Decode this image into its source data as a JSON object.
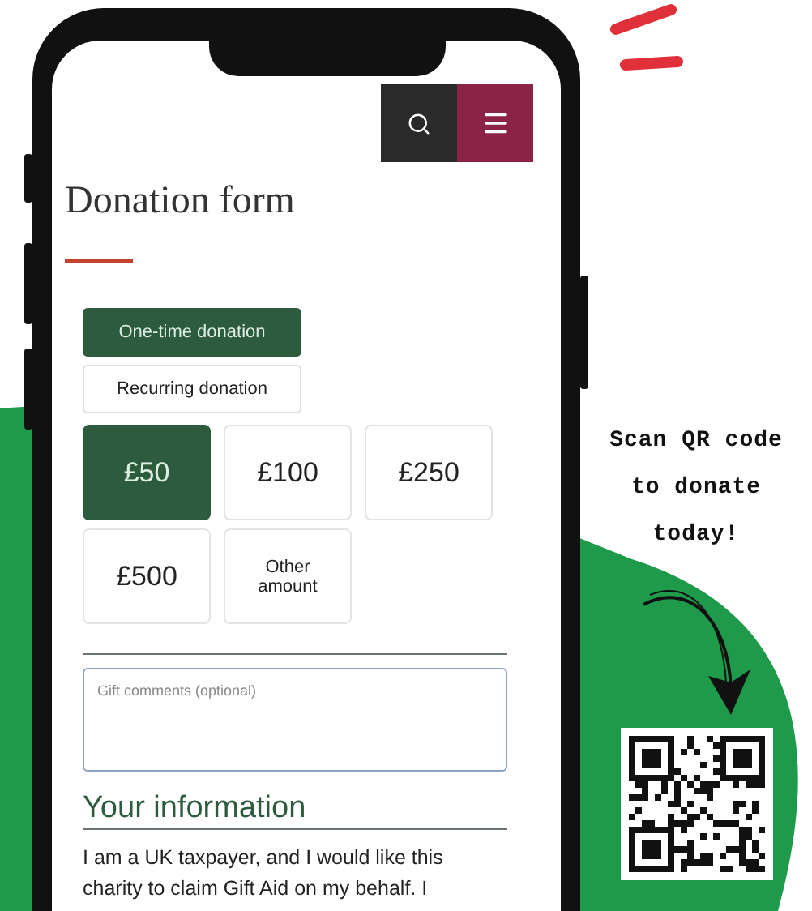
{
  "phone_screen": {
    "title": "Donation form",
    "donation_types": [
      {
        "label": "One-time donation",
        "selected": true
      },
      {
        "label": "Recurring donation",
        "selected": false
      }
    ],
    "amounts": [
      {
        "label": "£50",
        "selected": true
      },
      {
        "label": "£100",
        "selected": false
      },
      {
        "label": "£250",
        "selected": false
      },
      {
        "label": "£500",
        "selected": false
      },
      {
        "label": "Other amount",
        "selected": false
      }
    ],
    "comments_field": {
      "placeholder": "Gift comments (optional)"
    },
    "section_heading": "Your information",
    "gift_aid_text": "I am a UK taxpayer, and I would like this charity to claim Gift Aid on my behalf. I"
  },
  "promo": {
    "text": "Scan QR code to donate today!"
  }
}
